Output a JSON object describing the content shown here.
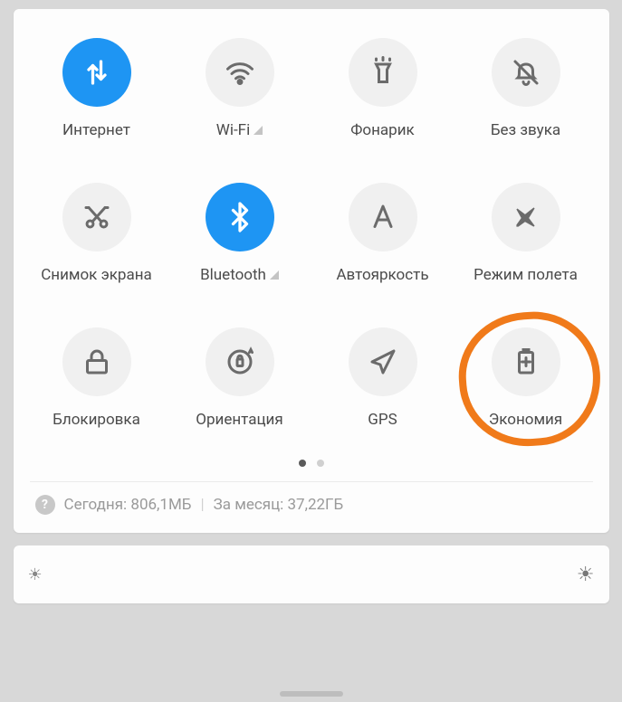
{
  "tiles": [
    {
      "name": "internet",
      "label": "Интернет",
      "active": true,
      "extra": null
    },
    {
      "name": "wifi",
      "label": "Wi-Fi",
      "active": false,
      "extra": "signal"
    },
    {
      "name": "flashlight",
      "label": "Фонарик",
      "active": false,
      "extra": null
    },
    {
      "name": "mute",
      "label": "Без звука",
      "active": false,
      "extra": null
    },
    {
      "name": "screenshot",
      "label": "Снимок экрана",
      "active": false,
      "extra": null
    },
    {
      "name": "bluetooth",
      "label": "Bluetooth",
      "active": true,
      "extra": "signal"
    },
    {
      "name": "autobright",
      "label": "Автояркость",
      "active": false,
      "extra": null
    },
    {
      "name": "airplane",
      "label": "Режим полета",
      "active": false,
      "extra": null
    },
    {
      "name": "lock",
      "label": "Блокировка",
      "active": false,
      "extra": null
    },
    {
      "name": "orientation",
      "label": "Ориентация",
      "active": false,
      "extra": null
    },
    {
      "name": "gps",
      "label": "GPS",
      "active": false,
      "extra": null
    },
    {
      "name": "battery",
      "label": "Экономия",
      "active": false,
      "extra": null
    }
  ],
  "usage": {
    "today_prefix": "Сегодня:",
    "today_value": "806,1МБ",
    "month_prefix": "За месяц:",
    "month_value": "37,22ГБ"
  },
  "pagination": {
    "total": 2,
    "current": 0
  },
  "annotation_target": "battery"
}
